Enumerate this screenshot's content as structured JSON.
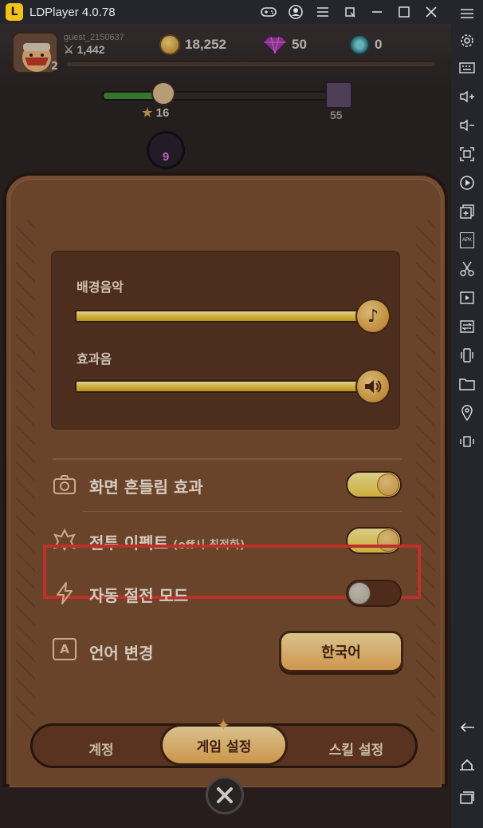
{
  "window": {
    "title": "LDPlayer 4.0.78",
    "logo_letter": "L",
    "controls": [
      "gamepad-icon",
      "account-icon",
      "menu-icon",
      "popout-icon",
      "minimize-icon",
      "maximize-icon",
      "close-icon"
    ]
  },
  "toolbar": {
    "tools": [
      "settings-icon",
      "keyboard-icon",
      "volume-up-icon",
      "volume-down-icon",
      "screenshot-fullscreen-icon",
      "record-icon",
      "add-instance-icon",
      "apk-icon",
      "scissors-icon",
      "video-icon",
      "sync-icon",
      "shake-icon",
      "folder-icon",
      "location-icon",
      "rotate-icon",
      "back-icon",
      "home-icon",
      "recent-apps-icon"
    ],
    "apk_label": "APK"
  },
  "hud": {
    "player_name": "guest_2150637",
    "power": "1,442",
    "level": "2",
    "gold": "18,252",
    "gems": "50",
    "tokens": "0",
    "stars": "16",
    "enemy_level": "55",
    "stage": "9"
  },
  "settings": {
    "bgm_label": "배경음악",
    "sfx_label": "효과음",
    "bgm_level": 1.0,
    "sfx_level": 1.0,
    "screen_shake_label": "화면 흔들림 효과",
    "screen_shake_on": true,
    "battle_effect_label": "전투 이펙트",
    "battle_effect_sub": "(off시 최적화)",
    "battle_effect_on": true,
    "power_save_label": "자동 절전 모드",
    "power_save_on": false,
    "language_label": "언어 변경",
    "language_value": "한국어",
    "language_icon_glyph": "A"
  },
  "tabs": {
    "account": "계정",
    "game": "게임 설정",
    "skill": "스킬 설정",
    "active": "game"
  },
  "colors": {
    "highlight": "#e03a33",
    "panel": "#7d4f33",
    "toggle_on": "#f1cd47"
  }
}
